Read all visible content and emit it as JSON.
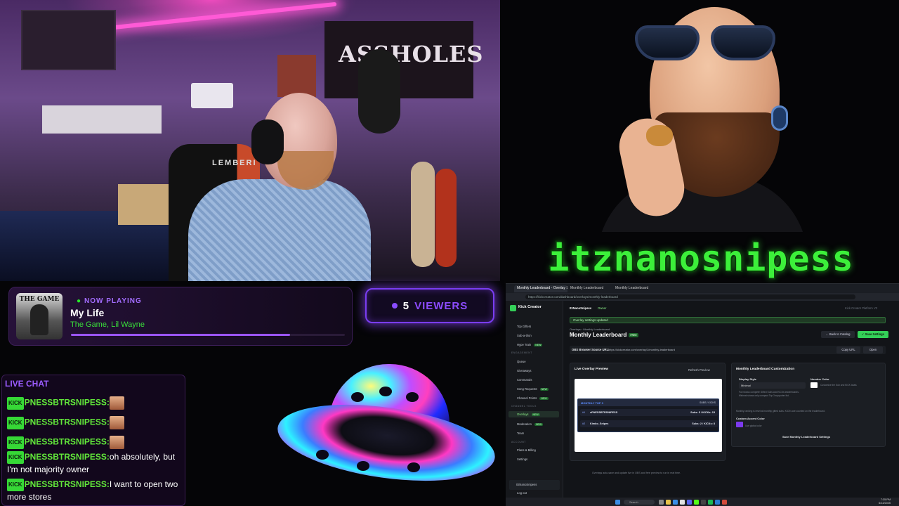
{
  "webcam": {
    "banner_text": "ASSHOLES",
    "chair_brand": "LEMBERI"
  },
  "channel": {
    "name": "itznanosnipess"
  },
  "now_playing": {
    "label": "NOW PLAYING",
    "title": "My Life",
    "artist": "The Game, Lil Wayne",
    "album_art_text": "THE GAME",
    "progress": 0.8
  },
  "viewers": {
    "count": "5",
    "label": "VIEWERS"
  },
  "chat": {
    "header": "LIVE CHAT",
    "badge": "KICK",
    "messages": [
      {
        "user": "PNESSBTRSNIPESS:",
        "text": "",
        "emote": true
      },
      {
        "user": "PNESSBTRSNIPESS:",
        "text": "",
        "emote": true
      },
      {
        "user": "PNESSBTRSNIPESS:",
        "text": "",
        "emote": true
      },
      {
        "user": "PNESSBTRSNIPESS:",
        "text": "oh absolutely, but I'm not majority owner",
        "emote": false
      },
      {
        "user": "PNESSBTRSNIPESS:",
        "text": "I want to open two more stores",
        "emote": false
      }
    ]
  },
  "browser": {
    "tabs": [
      "Monthly Leaderboard - Overlay St...",
      "Monthly Leaderboard",
      "Monthly Leaderboard"
    ],
    "url": "https://kickcreator.com/dashboard/overlays/monthly-leaderboard",
    "app_name": "Kick Creator",
    "sidebar": {
      "items": [
        {
          "label": "Top Gifters"
        },
        {
          "label": "Sub-a-thon"
        },
        {
          "label": "Hype Train",
          "pill": "NEW"
        },
        {
          "label": "Queue"
        },
        {
          "label": "Giveaways"
        },
        {
          "label": "Commands"
        },
        {
          "label": "Song Requests",
          "pill": "NEW"
        },
        {
          "label": "Channel Points",
          "pill": "NEW"
        },
        {
          "label": "Overlays",
          "pill": "NEW",
          "selected": true
        },
        {
          "label": "Moderation",
          "pill": "NEW"
        },
        {
          "label": "Team"
        },
        {
          "label": "Plans & Billing"
        },
        {
          "label": "Settings"
        }
      ],
      "groups": [
        "ENGAGEMENT",
        "CHANNEL TOOLS",
        "ACCOUNT"
      ],
      "user": "ItzNanoSnipess",
      "logout": "Log out"
    },
    "top_user": "ItzNanoSnipess",
    "top_user_badge": "Owner",
    "toast": "Overlay settings updated",
    "breadcrumb": "Overlays  ›  Monthly Leaderboard",
    "page_title": "Monthly Leaderboard",
    "page_badge": "FREE",
    "back_button": "← Back to Catalog",
    "save_button": "✓ Save Settings",
    "obs_label": "OBS Browser Source URL:",
    "obs_url": "https://kickcreator.com/overlay/1/monthly-leaderboard",
    "copy_button": "Copy URL",
    "open_button": "Open",
    "preview": {
      "title": "Live Overlay Preview",
      "refresh": "Refresh Preview",
      "lb_title": "MONTHLY TOP 3",
      "lb_right": "SUBS / KICKS",
      "rows": [
        {
          "rank": "#1",
          "name": "xPNESSBTRSNIPESS",
          "score": "Subs: 5 / KICKs: 15"
        },
        {
          "rank": "#2",
          "name": "Kimbo_Snipes",
          "score": "Subs: 2 / KICKs: 8"
        }
      ]
    },
    "customize": {
      "title": "Monthly Leaderboard Customization",
      "display_style_label": "Display Style",
      "display_style_value": "Minimal",
      "display_hint": "Full shows complete Gifted Subs and KICKs leaderboards. Minimal shows only compact Top 3 supporter list.",
      "number_color_label": "Number Color",
      "number_color_hint": "Customize the Sub and KICK totals",
      "accent_label": "Custom Accent Color",
      "accent_color": "#7c3aed",
      "accent_hint": "Use global color",
      "info": "Monthly ranking is reset at monthly gifted subs. KICKs are counted on the leaderboard.",
      "save_label": "Save Monthly Leaderboard Settings"
    },
    "footnote": "Overlays auto-save and update live in OBS and free preview to run in real time.",
    "taskbar_search": "Search",
    "clock_time": "7:35 PM",
    "clock_date": "6/14/2025",
    "window_title_right": "Kick Creator Platform V3"
  },
  "colors": {
    "accent_purple": "#8d4cff",
    "accent_green": "#3cf03a",
    "kick_green": "#34d058"
  }
}
